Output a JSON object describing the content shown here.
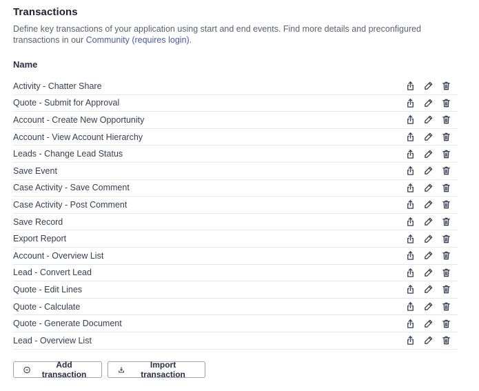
{
  "section": {
    "title": "Transactions",
    "description_prefix": "Define key transactions of your application using start and end events. Find more details and preconfigured transactions in our ",
    "community_link": "Community",
    "requires_login": "(requires login).",
    "column_header": "Name"
  },
  "transactions": [
    "Activity - Chatter Share",
    "Quote - Submit for Approval",
    "Account - Create New Opportunity",
    "Account - View Account Hierarchy",
    "Leads - Change Lead Status",
    "Save Event",
    "Case Activity - Save Comment",
    "Case Activity - Post Comment",
    "Save Record",
    "Export Report",
    "Account - Overview List",
    "Lead - Convert Lead",
    "Quote - Edit Lines",
    "Quote - Calculate",
    "Quote - Generate Document",
    "Lead - Overview List"
  ],
  "row_icons": [
    "export-icon",
    "edit-pencil-icon",
    "trash-icon"
  ],
  "buttons": {
    "add_label": "Add transaction",
    "import_label": "Import transaction"
  }
}
